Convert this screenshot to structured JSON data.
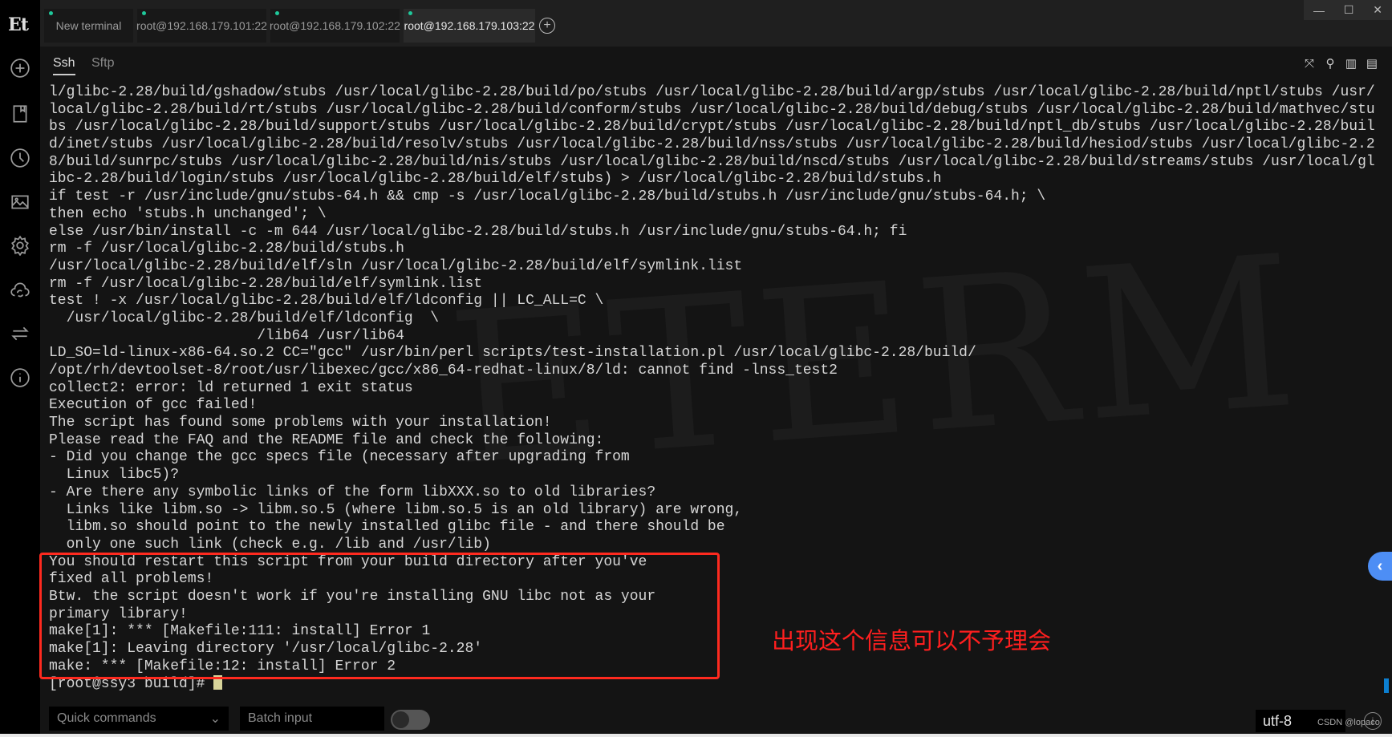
{
  "app": {
    "logo": "Et"
  },
  "sidebar": {
    "icons": [
      "plus-circle-icon",
      "bookmark-icon",
      "clock-icon",
      "image-icon",
      "gear-icon",
      "cloud-sync-icon",
      "transfer-arrows-icon",
      "info-icon"
    ]
  },
  "tabs": [
    {
      "label": "New terminal",
      "active": false
    },
    {
      "label": "root@192.168.179.101:22",
      "active": false
    },
    {
      "label": "root@192.168.179.102:22",
      "active": false
    },
    {
      "label": "root@192.168.179.103:22",
      "active": true
    }
  ],
  "window_controls": {
    "minimize": "—",
    "maximize": "☐",
    "close": "✕"
  },
  "subtabs": [
    {
      "label": "Ssh",
      "active": true
    },
    {
      "label": "Sftp",
      "active": false
    }
  ],
  "terminal": {
    "lines": [
      "l/glibc-2.28/build/gshadow/stubs /usr/local/glibc-2.28/build/po/stubs /usr/local/glibc-2.28/build/argp/stubs /usr/local/glibc-2.28/build/nptl/stubs /usr/",
      "local/glibc-2.28/build/rt/stubs /usr/local/glibc-2.28/build/conform/stubs /usr/local/glibc-2.28/build/debug/stubs /usr/local/glibc-2.28/build/mathvec/stu",
      "bs /usr/local/glibc-2.28/build/support/stubs /usr/local/glibc-2.28/build/crypt/stubs /usr/local/glibc-2.28/build/nptl_db/stubs /usr/local/glibc-2.28/buil",
      "d/inet/stubs /usr/local/glibc-2.28/build/resolv/stubs /usr/local/glibc-2.28/build/nss/stubs /usr/local/glibc-2.28/build/hesiod/stubs /usr/local/glibc-2.2",
      "8/build/sunrpc/stubs /usr/local/glibc-2.28/build/nis/stubs /usr/local/glibc-2.28/build/nscd/stubs /usr/local/glibc-2.28/build/streams/stubs /usr/local/gl",
      "ibc-2.28/build/login/stubs /usr/local/glibc-2.28/build/elf/stubs) > /usr/local/glibc-2.28/build/stubs.h",
      "if test -r /usr/include/gnu/stubs-64.h && cmp -s /usr/local/glibc-2.28/build/stubs.h /usr/include/gnu/stubs-64.h; \\",
      "then echo 'stubs.h unchanged'; \\",
      "else /usr/bin/install -c -m 644 /usr/local/glibc-2.28/build/stubs.h /usr/include/gnu/stubs-64.h; fi",
      "rm -f /usr/local/glibc-2.28/build/stubs.h",
      "/usr/local/glibc-2.28/build/elf/sln /usr/local/glibc-2.28/build/elf/symlink.list",
      "rm -f /usr/local/glibc-2.28/build/elf/symlink.list",
      "test ! -x /usr/local/glibc-2.28/build/elf/ldconfig || LC_ALL=C \\",
      "  /usr/local/glibc-2.28/build/elf/ldconfig  \\",
      "                        /lib64 /usr/lib64",
      "LD_SO=ld-linux-x86-64.so.2 CC=\"gcc\" /usr/bin/perl scripts/test-installation.pl /usr/local/glibc-2.28/build/",
      "/opt/rh/devtoolset-8/root/usr/libexec/gcc/x86_64-redhat-linux/8/ld: cannot find -lnss_test2",
      "collect2: error: ld returned 1 exit status",
      "Execution of gcc failed!",
      "The script has found some problems with your installation!",
      "Please read the FAQ and the README file and check the following:",
      "- Did you change the gcc specs file (necessary after upgrading from",
      "  Linux libc5)?",
      "- Are there any symbolic links of the form libXXX.so to old libraries?",
      "  Links like libm.so -> libm.so.5 (where libm.so.5 is an old library) are wrong,",
      "  libm.so should point to the newly installed glibc file - and there should be",
      "  only one such link (check e.g. /lib and /usr/lib)",
      "You should restart this script from your build directory after you've",
      "fixed all problems!",
      "Btw. the script doesn't work if you're installing GNU libc not as your",
      "primary library!",
      "make[1]: *** [Makefile:111: install] Error 1",
      "make[1]: Leaving directory '/usr/local/glibc-2.28'",
      "make: *** [Makefile:12: install] Error 2"
    ],
    "prompt": "[root@ssy3 build]# "
  },
  "annotation": {
    "text": "出现这个信息可以不予理会",
    "color": "#ff1f1f"
  },
  "watermark": "ETERM",
  "bottom": {
    "quick_commands": "Quick commands",
    "quick_commands_chevron": "⌄",
    "batch_input_placeholder": "Batch input",
    "batch_toggle_on": false,
    "encoding": "utf-8",
    "credit": "CSDN @lopaco"
  },
  "colors": {
    "accent": "#4d8ef5",
    "status_dot": "#1fc99b",
    "highlight_box": "#ff2a1f"
  }
}
